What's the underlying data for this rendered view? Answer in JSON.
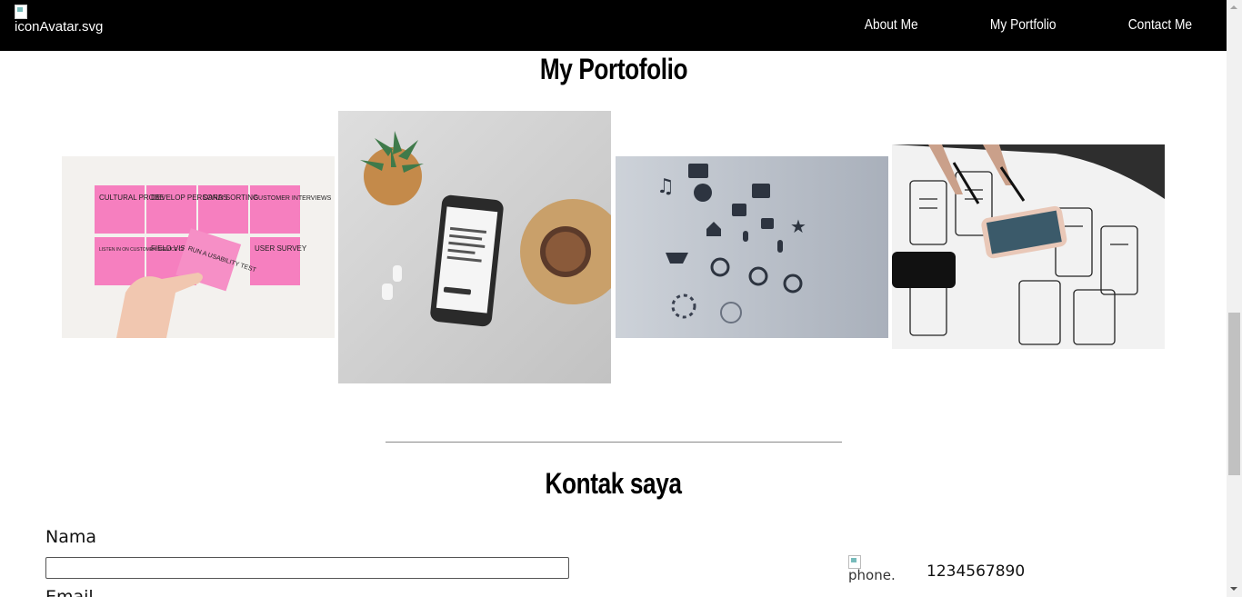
{
  "navbar": {
    "logo_alt": "iconAvatar.svg",
    "links": [
      "About Me",
      "My Portfolio",
      "Contact Me"
    ]
  },
  "portfolio": {
    "title": "My Portofolio",
    "images": [
      {
        "name": "sticky-notes-image"
      },
      {
        "name": "phone-desk-image"
      },
      {
        "name": "icons-image"
      },
      {
        "name": "wireframes-image"
      }
    ],
    "sticky_notes": [
      "CULTURAL PROBE",
      "DEVELOP PERSONAS",
      "CARD SORTING",
      "CUSTOMER INTERVIEWS",
      "LISTEN IN ON CUSTOMER SERVICE CALLS",
      "FIELD VISITS",
      "RUN A USABILITY TEST",
      "USER SURVEY"
    ]
  },
  "contact": {
    "title": "Kontak saya",
    "name_label": "Nama",
    "email_label": "Email",
    "name_value": "",
    "phone_icon_alt": "phone.",
    "phone_number": "1234567890"
  },
  "colors": {
    "navbar_bg": "#000000",
    "sticky_note": "#f67fbf"
  }
}
